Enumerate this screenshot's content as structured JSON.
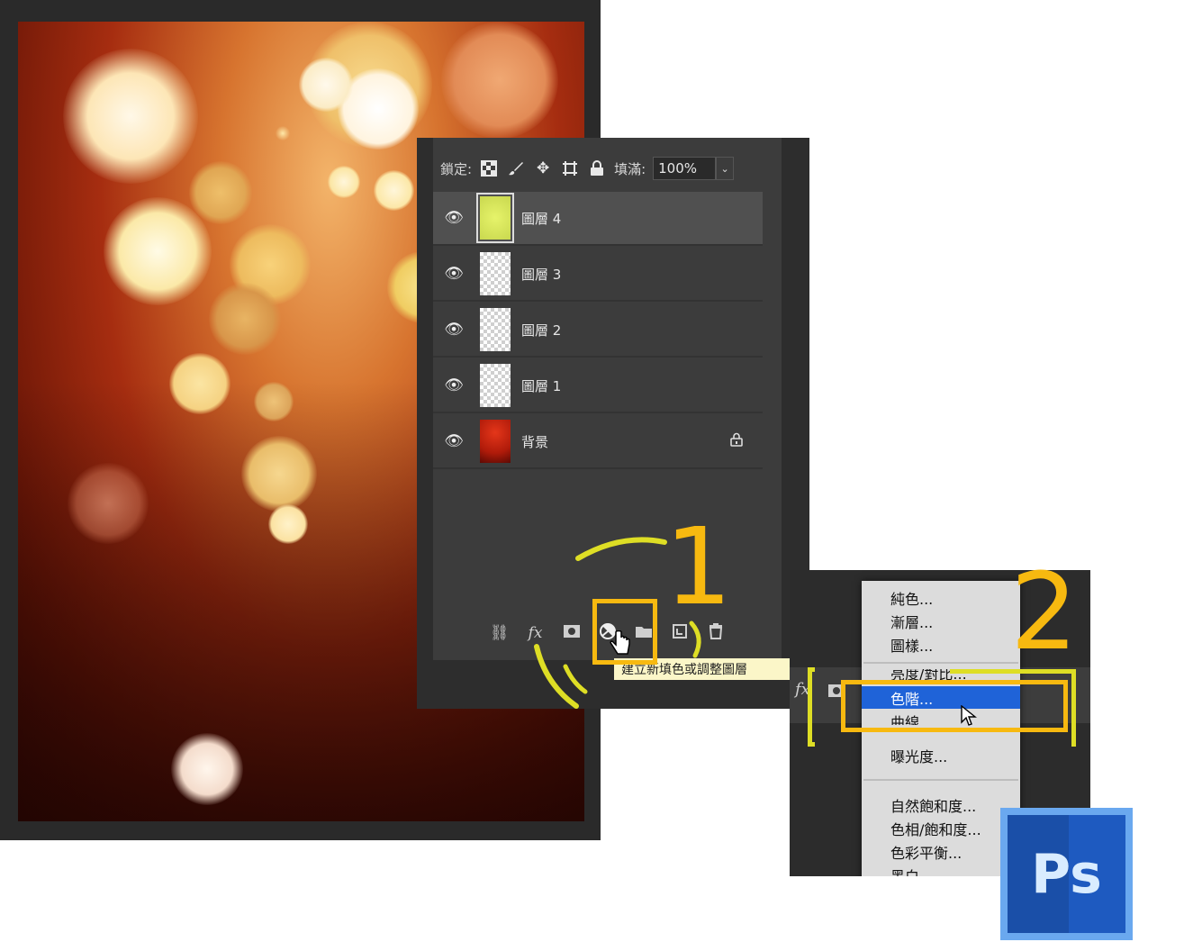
{
  "layers_panel": {
    "lock_label": "鎖定:",
    "fill_label": "填滿:",
    "fill_value": "100%",
    "layers": [
      {
        "name": "圖層 4",
        "selected": true,
        "thumb": "yellow",
        "locked": false
      },
      {
        "name": "圖層 3",
        "selected": false,
        "thumb": "transparent",
        "locked": false
      },
      {
        "name": "圖層 2",
        "selected": false,
        "thumb": "transparent",
        "locked": false
      },
      {
        "name": "圖層 1",
        "selected": false,
        "thumb": "transparent",
        "locked": false
      },
      {
        "name": "背景",
        "selected": false,
        "thumb": "red",
        "locked": true
      }
    ],
    "tooltip": "建立新填色或調整圖層"
  },
  "steps": {
    "one": "1",
    "two": "2"
  },
  "adjust_menu": {
    "items": [
      {
        "label": "純色..."
      },
      {
        "label": "漸層..."
      },
      {
        "label": "圖樣..."
      },
      {
        "label": "亮度/對比..."
      },
      {
        "label": "色階...",
        "active": true
      },
      {
        "label": "曲線..."
      },
      {
        "label": "曝光度..."
      },
      {
        "label": "自然飽和度..."
      },
      {
        "label": "色相/飽和度..."
      },
      {
        "label": "色彩平衡..."
      },
      {
        "label": "黑白..."
      }
    ]
  },
  "logo": {
    "text": "Ps"
  },
  "colors": {
    "highlight": "#f7b910",
    "menu_active": "#1f63d8",
    "ps_blue": "#1a4fa8"
  }
}
